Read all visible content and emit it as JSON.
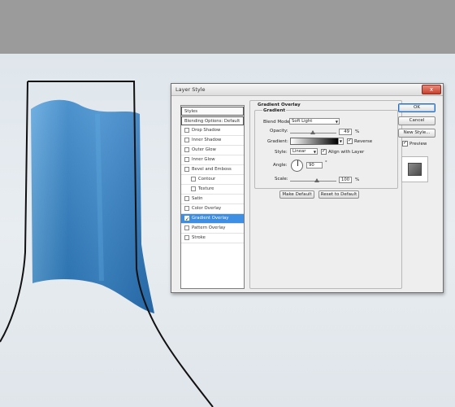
{
  "dialog": {
    "title": "Layer Style",
    "close_glyph": "x",
    "styles_list": [
      {
        "label": "Styles",
        "type": "header"
      },
      {
        "label": "Blending Options: Default",
        "type": "header"
      },
      {
        "label": "Drop Shadow",
        "checked": false
      },
      {
        "label": "Inner Shadow",
        "checked": false
      },
      {
        "label": "Outer Glow",
        "checked": false
      },
      {
        "label": "Inner Glow",
        "checked": false
      },
      {
        "label": "Bevel and Emboss",
        "checked": false
      },
      {
        "label": "Contour",
        "checked": false,
        "indent": true
      },
      {
        "label": "Texture",
        "checked": false,
        "indent": true
      },
      {
        "label": "Satin",
        "checked": false
      },
      {
        "label": "Color Overlay",
        "checked": false
      },
      {
        "label": "Gradient Overlay",
        "checked": true,
        "selected": true
      },
      {
        "label": "Pattern Overlay",
        "checked": false
      },
      {
        "label": "Stroke",
        "checked": false
      }
    ],
    "section_title": "Gradient Overlay",
    "group_title": "Gradient",
    "blend_mode_label": "Blend Mode:",
    "blend_mode_value": "Soft Light",
    "opacity_label": "Opacity:",
    "opacity_value": "49",
    "percent": "%",
    "opacity_level": 0.49,
    "gradient_label": "Gradient:",
    "reverse_label": "Reverse",
    "reverse_checked": true,
    "style_label": "Style:",
    "style_value": "Linear",
    "align_label": "Align with Layer",
    "align_checked": true,
    "angle_label": "Angle:",
    "angle_value": "90",
    "degree": "°",
    "scale_label": "Scale:",
    "scale_value": "100",
    "make_default": "Make Default",
    "reset_default": "Reset to Default",
    "ok": "OK",
    "cancel": "Cancel",
    "new_style": "New Style...",
    "preview_label": "Preview",
    "preview_checked": true
  },
  "colors": {
    "selection": "#3e8ee3",
    "artwork_blue": "#3a86c9",
    "canvas": "#e3e9ee"
  }
}
